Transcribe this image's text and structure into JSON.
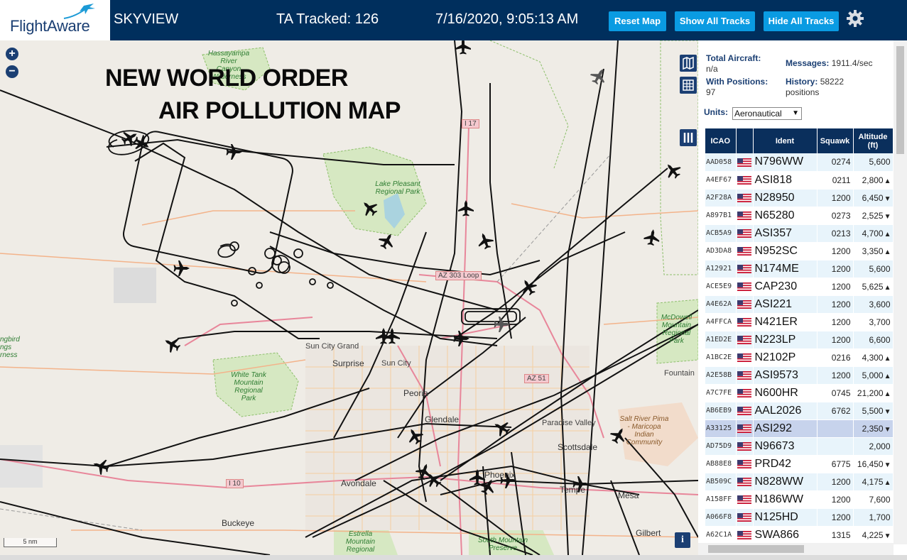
{
  "header": {
    "logo_text": "FlightAware",
    "title": "SKYVIEW",
    "tracked": "TA Tracked: 126",
    "datetime": "7/16/2020, 9:05:13 AM",
    "buttons": {
      "reset": "Reset Map",
      "show_all": "Show All Tracks",
      "hide_all": "Hide All Tracks"
    },
    "settings_icon": "gear-icon"
  },
  "map": {
    "overlay_title_line1": "NEW WORLD ORDER",
    "overlay_title_line2": "AIR POLLUTION MAP",
    "zoom_in": "+",
    "zoom_out": "−",
    "scale": "5 nm",
    "info": "i",
    "labels": {
      "hassayampa": "Hassayampa River Canyon Wilderness",
      "lake_pleasant": "Lake Pleasant Regional Park",
      "az303": "AZ 303 Loop",
      "mcdowell": "McDowell Mountain Regional Park",
      "sun_city_grand": "Sun City Grand",
      "surprise": "Surprise",
      "sun_city": "Sun City",
      "white_tank": "White Tank Mountain Regional Park",
      "peoria": "Peoria",
      "glendale": "Glendale",
      "az51": "AZ 51",
      "paradise_valley": "Paradise Valley",
      "scottsdale": "Scottsdale",
      "salt_river": "Salt River Pima - Maricopa Indian Community",
      "fountain": "Fountain",
      "avondale": "Avondale",
      "phoenix": "Phoenix",
      "tempe": "Tempe",
      "mesa": "Mesa",
      "i10": "I 10",
      "buckeye": "Buckeye",
      "estrella": "Estrella Mountain Regional",
      "south_mountain": "South Mountain Preserve",
      "gilbert": "Gilbert",
      "ngbird": "ngbird ngs rness",
      "i17": "I 17"
    }
  },
  "panel": {
    "total_aircraft_label": "Total Aircraft:",
    "total_aircraft_value": "n/a",
    "with_positions_label": "With Positions:",
    "with_positions_value": "97",
    "messages_label": "Messages:",
    "messages_value": "1911.4/sec",
    "history_label": "History:",
    "history_value": "58222 positions",
    "units_label": "Units:",
    "units_value": "Aeronautical",
    "columns": [
      "ICAO",
      "",
      "Ident",
      "Squawk",
      "Altitude (ft)"
    ],
    "rows": [
      {
        "icao": "AAD058",
        "ident": "N796WW",
        "squawk": "0274",
        "alt": "5,600",
        "trend": ""
      },
      {
        "icao": "A4EF67",
        "ident": "ASI818",
        "squawk": "0211",
        "alt": "2,800",
        "trend": "▲"
      },
      {
        "icao": "A2F28A",
        "ident": "N28950",
        "squawk": "1200",
        "alt": "6,450",
        "trend": "▼"
      },
      {
        "icao": "A897B1",
        "ident": "N65280",
        "squawk": "0273",
        "alt": "2,525",
        "trend": "▼"
      },
      {
        "icao": "ACB5A9",
        "ident": "ASI357",
        "squawk": "0213",
        "alt": "4,700",
        "trend": "▲"
      },
      {
        "icao": "AD3DA8",
        "ident": "N952SC",
        "squawk": "1200",
        "alt": "3,350",
        "trend": "▲"
      },
      {
        "icao": "A12921",
        "ident": "N174ME",
        "squawk": "1200",
        "alt": "5,600",
        "trend": ""
      },
      {
        "icao": "ACE5E9",
        "ident": "CAP230",
        "squawk": "1200",
        "alt": "5,625",
        "trend": "▲"
      },
      {
        "icao": "A4E62A",
        "ident": "ASI221",
        "squawk": "1200",
        "alt": "3,600",
        "trend": ""
      },
      {
        "icao": "A4FFCA",
        "ident": "N421ER",
        "squawk": "1200",
        "alt": "3,700",
        "trend": ""
      },
      {
        "icao": "A1ED2E",
        "ident": "N223LP",
        "squawk": "1200",
        "alt": "6,600",
        "trend": ""
      },
      {
        "icao": "A1BC2E",
        "ident": "N2102P",
        "squawk": "0216",
        "alt": "4,300",
        "trend": "▲"
      },
      {
        "icao": "A2E58B",
        "ident": "ASI9573",
        "squawk": "1200",
        "alt": "5,000",
        "trend": "▲"
      },
      {
        "icao": "A7C7FE",
        "ident": "N600HR",
        "squawk": "0745",
        "alt": "21,200",
        "trend": "▲"
      },
      {
        "icao": "AB6EB9",
        "ident": "AAL2026",
        "squawk": "6762",
        "alt": "5,500",
        "trend": "▼"
      },
      {
        "icao": "A33125",
        "ident": "ASI292",
        "squawk": "",
        "alt": "2,350",
        "trend": "▼"
      },
      {
        "icao": "AD75D9",
        "ident": "N96673",
        "squawk": "",
        "alt": "2,000",
        "trend": ""
      },
      {
        "icao": "AB88E8",
        "ident": "PRD42",
        "squawk": "6775",
        "alt": "16,450",
        "trend": "▼"
      },
      {
        "icao": "AB509C",
        "ident": "N828WW",
        "squawk": "1200",
        "alt": "4,175",
        "trend": "▲"
      },
      {
        "icao": "A158FF",
        "ident": "N186WW",
        "squawk": "1200",
        "alt": "7,600",
        "trend": ""
      },
      {
        "icao": "A066F8",
        "ident": "N125HD",
        "squawk": "1200",
        "alt": "1,700",
        "trend": ""
      },
      {
        "icao": "A62C1A",
        "ident": "SWA866",
        "squawk": "1315",
        "alt": "4,225",
        "trend": "▼"
      }
    ]
  },
  "colors": {
    "header_bg": "#002f5d",
    "button_bg": "#0a9be2",
    "table_header_bg": "#0a2f5c",
    "row_alt_bg": "#e8f4fb",
    "selected_row_bg": "#c7d3ec",
    "park_green": "#cde4b6",
    "track_color": "#111111"
  }
}
